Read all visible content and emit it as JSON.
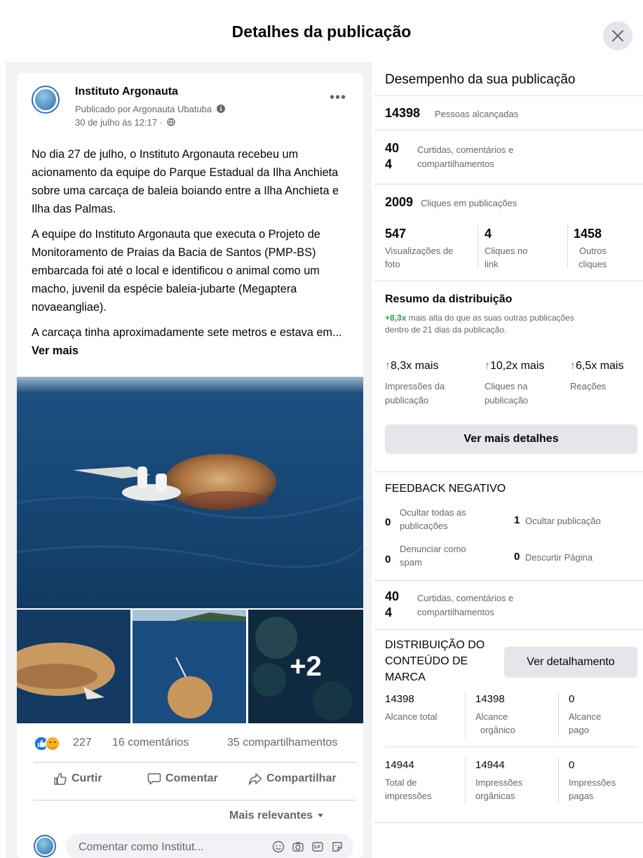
{
  "dialog": {
    "title": "Detalhes da publicação"
  },
  "post": {
    "page_name": "Instituto Argonauta",
    "published_by": "Publicado por Argonauta Ubatuba",
    "date": "30 de julho às 12:17 ·",
    "paragraphs": [
      "No dia 27 de julho, o Instituto Argonauta recebeu um acionamento da equipe do Parque Estadual da Ilha Anchieta sobre uma carcaça de baleia boiando entre a Ilha Anchieta e Ilha das Palmas.",
      "A equipe do Instituto Argonauta que executa o Projeto de Monitoramento de Praias da Bacia de Santos (PMP-BS) embarcada foi até o local e identificou o animal como um macho, juvenil da espécie baleia-jubarte (Megaptera novaeangliae).",
      "A carcaça tinha aproximadamente sete metros e estava em..."
    ],
    "see_more": "Ver mais",
    "more_photos": "+2",
    "reactions_count": "227",
    "comments": "16 comentários",
    "shares": "35 compartilhamentos",
    "actions": {
      "like": "Curtir",
      "comment": "Comentar",
      "share": "Compartilhar"
    },
    "sort": "Mais relevantes",
    "comment_placeholder": "Comentar como Institut..."
  },
  "performance": {
    "title": "Desempenho da sua publicação",
    "reach": {
      "value": "14398",
      "label": "Pessoas alcançadas"
    },
    "engagement": {
      "value_top": "40",
      "value_bottom": "4",
      "label_top": "Curtidas, comentários e",
      "label_bottom": "compartilhamentos"
    },
    "clicks": {
      "value": "2009",
      "label": "Cliques em publicações"
    },
    "click_breakdown": [
      {
        "value": "547",
        "label1": "Visualizações de",
        "label2": "foto"
      },
      {
        "value": "4",
        "label1": "Cliques no",
        "label2": "link"
      },
      {
        "value": "1458",
        "label1": "Outros",
        "label2": "cliques"
      }
    ]
  },
  "distribution_summary": {
    "title": "Resumo da distribuição",
    "highlight": "+8,3x",
    "text1": " mais alta do que as suas outras publicações",
    "text2": "dentro de 21 dias da publicação.",
    "metrics": [
      {
        "value": "8,3x mais",
        "label1": "Impressões da",
        "label2": "publicação"
      },
      {
        "value": "10,2x mais",
        "label1": "Cliques na",
        "label2": "publicação"
      },
      {
        "value": "6,5x mais",
        "label1": "Reações",
        "label2": ""
      }
    ],
    "button": "Ver mais detalhes"
  },
  "negative_feedback": {
    "title": "FEEDBACK NEGATIVO",
    "items": [
      {
        "value": "0",
        "label1": "Ocultar todas as",
        "label2": "publicações"
      },
      {
        "value": "1",
        "label1": "Ocultar publicação",
        "label2": ""
      },
      {
        "value": "0",
        "label1": "Denunciar como",
        "label2": "spam"
      },
      {
        "value": "0",
        "label1": "Descurtir Página",
        "label2": ""
      }
    ]
  },
  "engagement_repeat": {
    "value_top": "40",
    "value_bottom": "4",
    "label_top": "Curtidas, comentários e",
    "label_bottom": "compartilhamentos"
  },
  "branded_content": {
    "title1": "DISTRIBUIÇÃO DO",
    "title2": "CONTEÚDO DE",
    "title3": "MARCA",
    "button": "Ver detalhamento",
    "reach": [
      {
        "value": "14398",
        "label1": "Alcance total",
        "label2": ""
      },
      {
        "value": "14398",
        "label1": "Alcance",
        "label2": "orgânico"
      },
      {
        "value": "0",
        "label1": "Alcance",
        "label2": "pago"
      }
    ],
    "impressions": [
      {
        "value": "14944",
        "label1": "Total de",
        "label2": "impressões"
      },
      {
        "value": "14944",
        "label1": "Impressões",
        "label2": "orgânicas"
      },
      {
        "value": "0",
        "label1": "Impressões",
        "label2": "pagas"
      }
    ]
  },
  "colors": {
    "accent_green": "#31a24c",
    "facebook_blue": "#1877f2",
    "panel_bg": "#f0f2f5"
  }
}
